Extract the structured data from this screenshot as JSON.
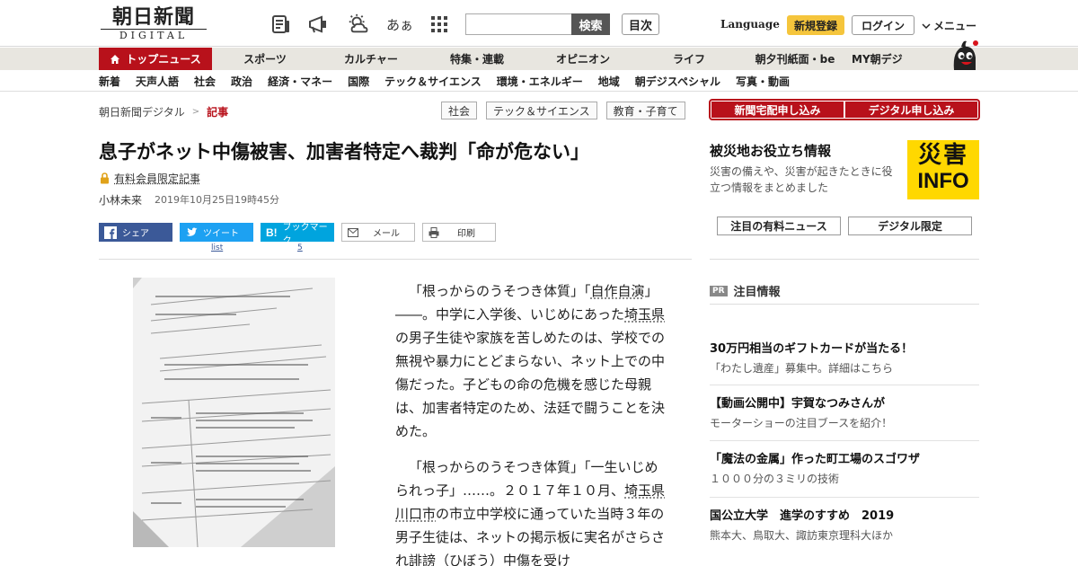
{
  "header": {
    "logo_main": "朝日新聞",
    "logo_sub": "DIGITAL",
    "search_button": "検索",
    "toc_button": "目次",
    "language": "Language",
    "signup": "新規登録",
    "login": "ログイン",
    "menu": "メニュー",
    "font_size_icon_text": "あぁ"
  },
  "nav_primary": [
    "トップニュース",
    "スポーツ",
    "カルチャー",
    "特集・連載",
    "オピニオン",
    "ライフ",
    "朝夕刊紙面・be",
    "MY朝デジ"
  ],
  "nav_secondary": [
    "新着",
    "天声人語",
    "社会",
    "政治",
    "経済・マネー",
    "国際",
    "テック＆サイエンス",
    "環境・エネルギー",
    "地域",
    "朝デジスペシャル",
    "写真・動画"
  ],
  "breadcrumb": {
    "home": "朝日新聞デジタル",
    "separator": ">",
    "current": "記事"
  },
  "tags": [
    "社会",
    "テック＆サイエンス",
    "教育・子育て"
  ],
  "article": {
    "title": "息子がネット中傷被害、加害者特定へ裁判「命が危ない」",
    "paid_label": "有料会員限定記事",
    "author": "小林未来",
    "date": "2019年10月25日19時45分",
    "share": {
      "facebook": "シェア",
      "twitter": "ツイート",
      "twitter_count": "list",
      "hatena": "ブックマーク",
      "hatena_count": "5",
      "mail": "メール",
      "print": "印刷"
    },
    "p1": {
      "a": "「根っからのうそつき体質」「",
      "link1": "自作自演",
      "b": "」――。中学に入学後、いじめにあった",
      "link2": "埼玉県",
      "c": "の男子生徒や家族を苦しめたのは、学校での無視や暴力にとどまらない、ネット上での中傷だった。子どもの命の危機を感じた母親は、加害者特定のため、法廷で闘うことを決めた。"
    },
    "p2": {
      "a": "「根っからのうそつき体質」「一生いじめられっ子」……。２０１７年１０月、",
      "link1": "埼玉県",
      "link2": "川口市",
      "b": "の市立中学校に通っていた当時３年の男子生徒は、ネットの掲示板に実名がさらされ誹謗（ひぼう）中傷を受け"
    }
  },
  "sidebar": {
    "subscribe_paper": "新聞宅配申し込み",
    "subscribe_digital": "デジタル申し込み",
    "disaster_title": "被災地お役立ち情報",
    "disaster_desc": "災害の備えや、災害が起きたときに役立つ情報をまとめました",
    "disaster_logo_top": "災害",
    "disaster_logo_bottom": "INFO",
    "pick_paid": "注目の有料ニュース",
    "pick_digital": "デジタル限定",
    "attention_badge": "PR",
    "attention_title": "注目情報",
    "promos": [
      {
        "title": "30万円相当のギフトカードが当たる！",
        "desc": "「わたし遺産」募集中。詳細はこちら"
      },
      {
        "title": "【動画公開中】宇賀なつみさんが",
        "desc": "モーターショーの注目ブースを紹介！"
      },
      {
        "title": "「魔法の金属」作った町工場のスゴワザ",
        "desc": "１０００分の３ミリの技術"
      },
      {
        "title": "国公立大学　進学のすすめ　2019",
        "desc": "熊本大、鳥取大、諏訪東京理科大ほか"
      }
    ]
  },
  "colors": {
    "brand_red": "#b8111b",
    "signup_yellow": "#f5c53c",
    "disaster_yellow": "#ffd800",
    "facebook": "#3b5998",
    "twitter": "#1da1f2",
    "hatena": "#00a4de"
  }
}
